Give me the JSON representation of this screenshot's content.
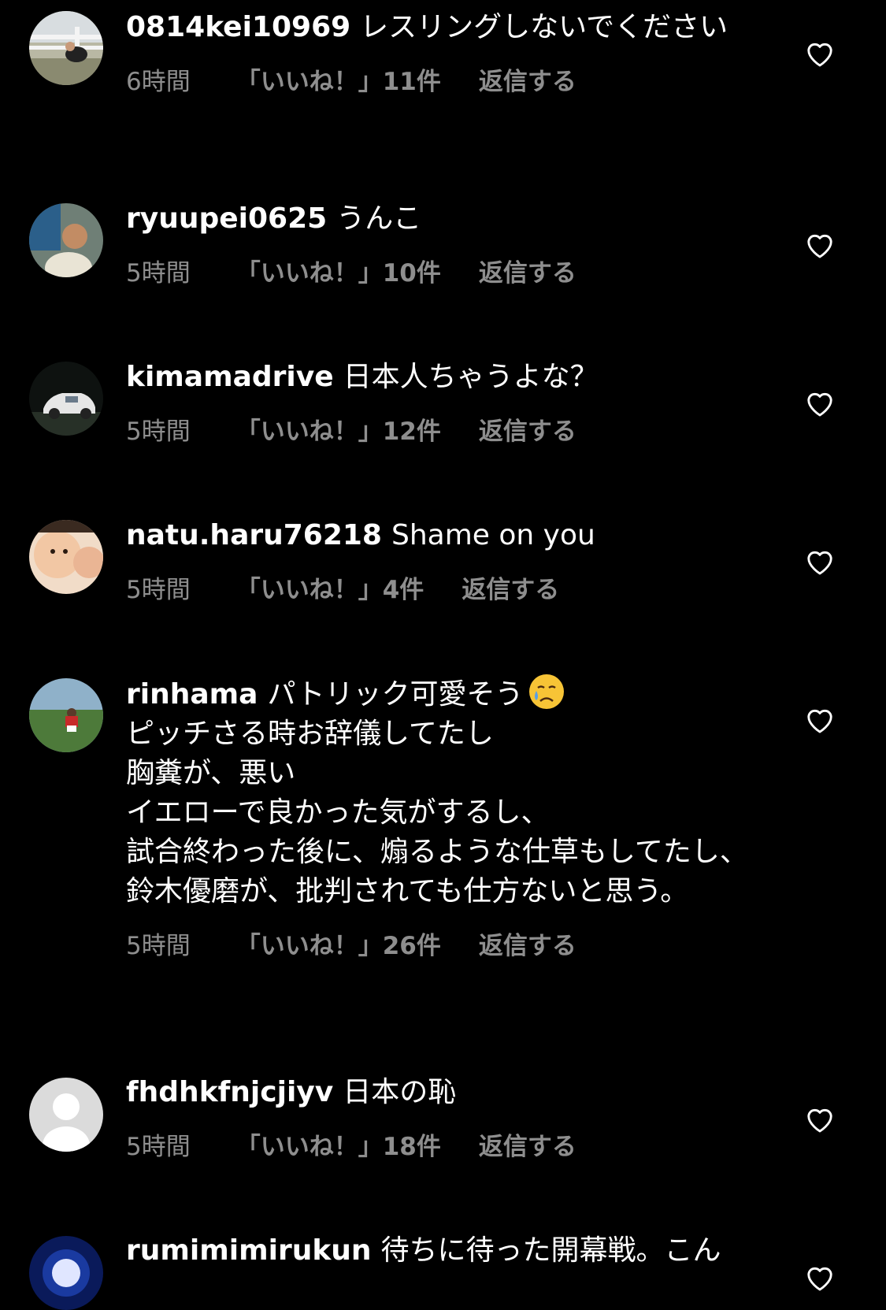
{
  "colors": {
    "background": "#000000",
    "text": "#ffffff",
    "meta": "#8e8e8e"
  },
  "comments": [
    {
      "username": "0814kei10969",
      "lines": [
        "レスリングしないでください"
      ],
      "time": "6時間",
      "likes": "「いいね！」11件",
      "reply": "返信する"
    },
    {
      "username": "ryuupei0625",
      "lines": [
        "うんこ"
      ],
      "time": "5時間",
      "likes": "「いいね！」10件",
      "reply": "返信する"
    },
    {
      "username": "kimamadrive",
      "lines": [
        "日本人ちゃうよな？"
      ],
      "time": "5時間",
      "likes": "「いいね！」12件",
      "reply": "返信する"
    },
    {
      "username": "natu.haru76218",
      "lines": [
        "Shame on you"
      ],
      "time": "5時間",
      "likes": "「いいね！」4件",
      "reply": "返信する"
    },
    {
      "username": "rinhama",
      "lines": [
        "パトリック可愛そう",
        "ピッチさる時お辞儀してたし",
        "胸糞が、悪い",
        "イエローで良かった気がするし、",
        "試合終わった後に、煽るような仕草もしてたし、鈴木優磨が、批判されても仕方ないと思う。"
      ],
      "emoji": "crying-face-emoji",
      "time": "5時間",
      "likes": "「いいね！」26件",
      "reply": "返信する"
    },
    {
      "username": "fhdhkfnjcjiyv",
      "lines": [
        "日本の恥"
      ],
      "time": "5時間",
      "likes": "「いいね！」18件",
      "reply": "返信する"
    },
    {
      "username": "rumimimirukun",
      "lines": [
        "待ちに待った開幕戦。こん"
      ],
      "time": "",
      "likes": "",
      "reply": ""
    }
  ]
}
